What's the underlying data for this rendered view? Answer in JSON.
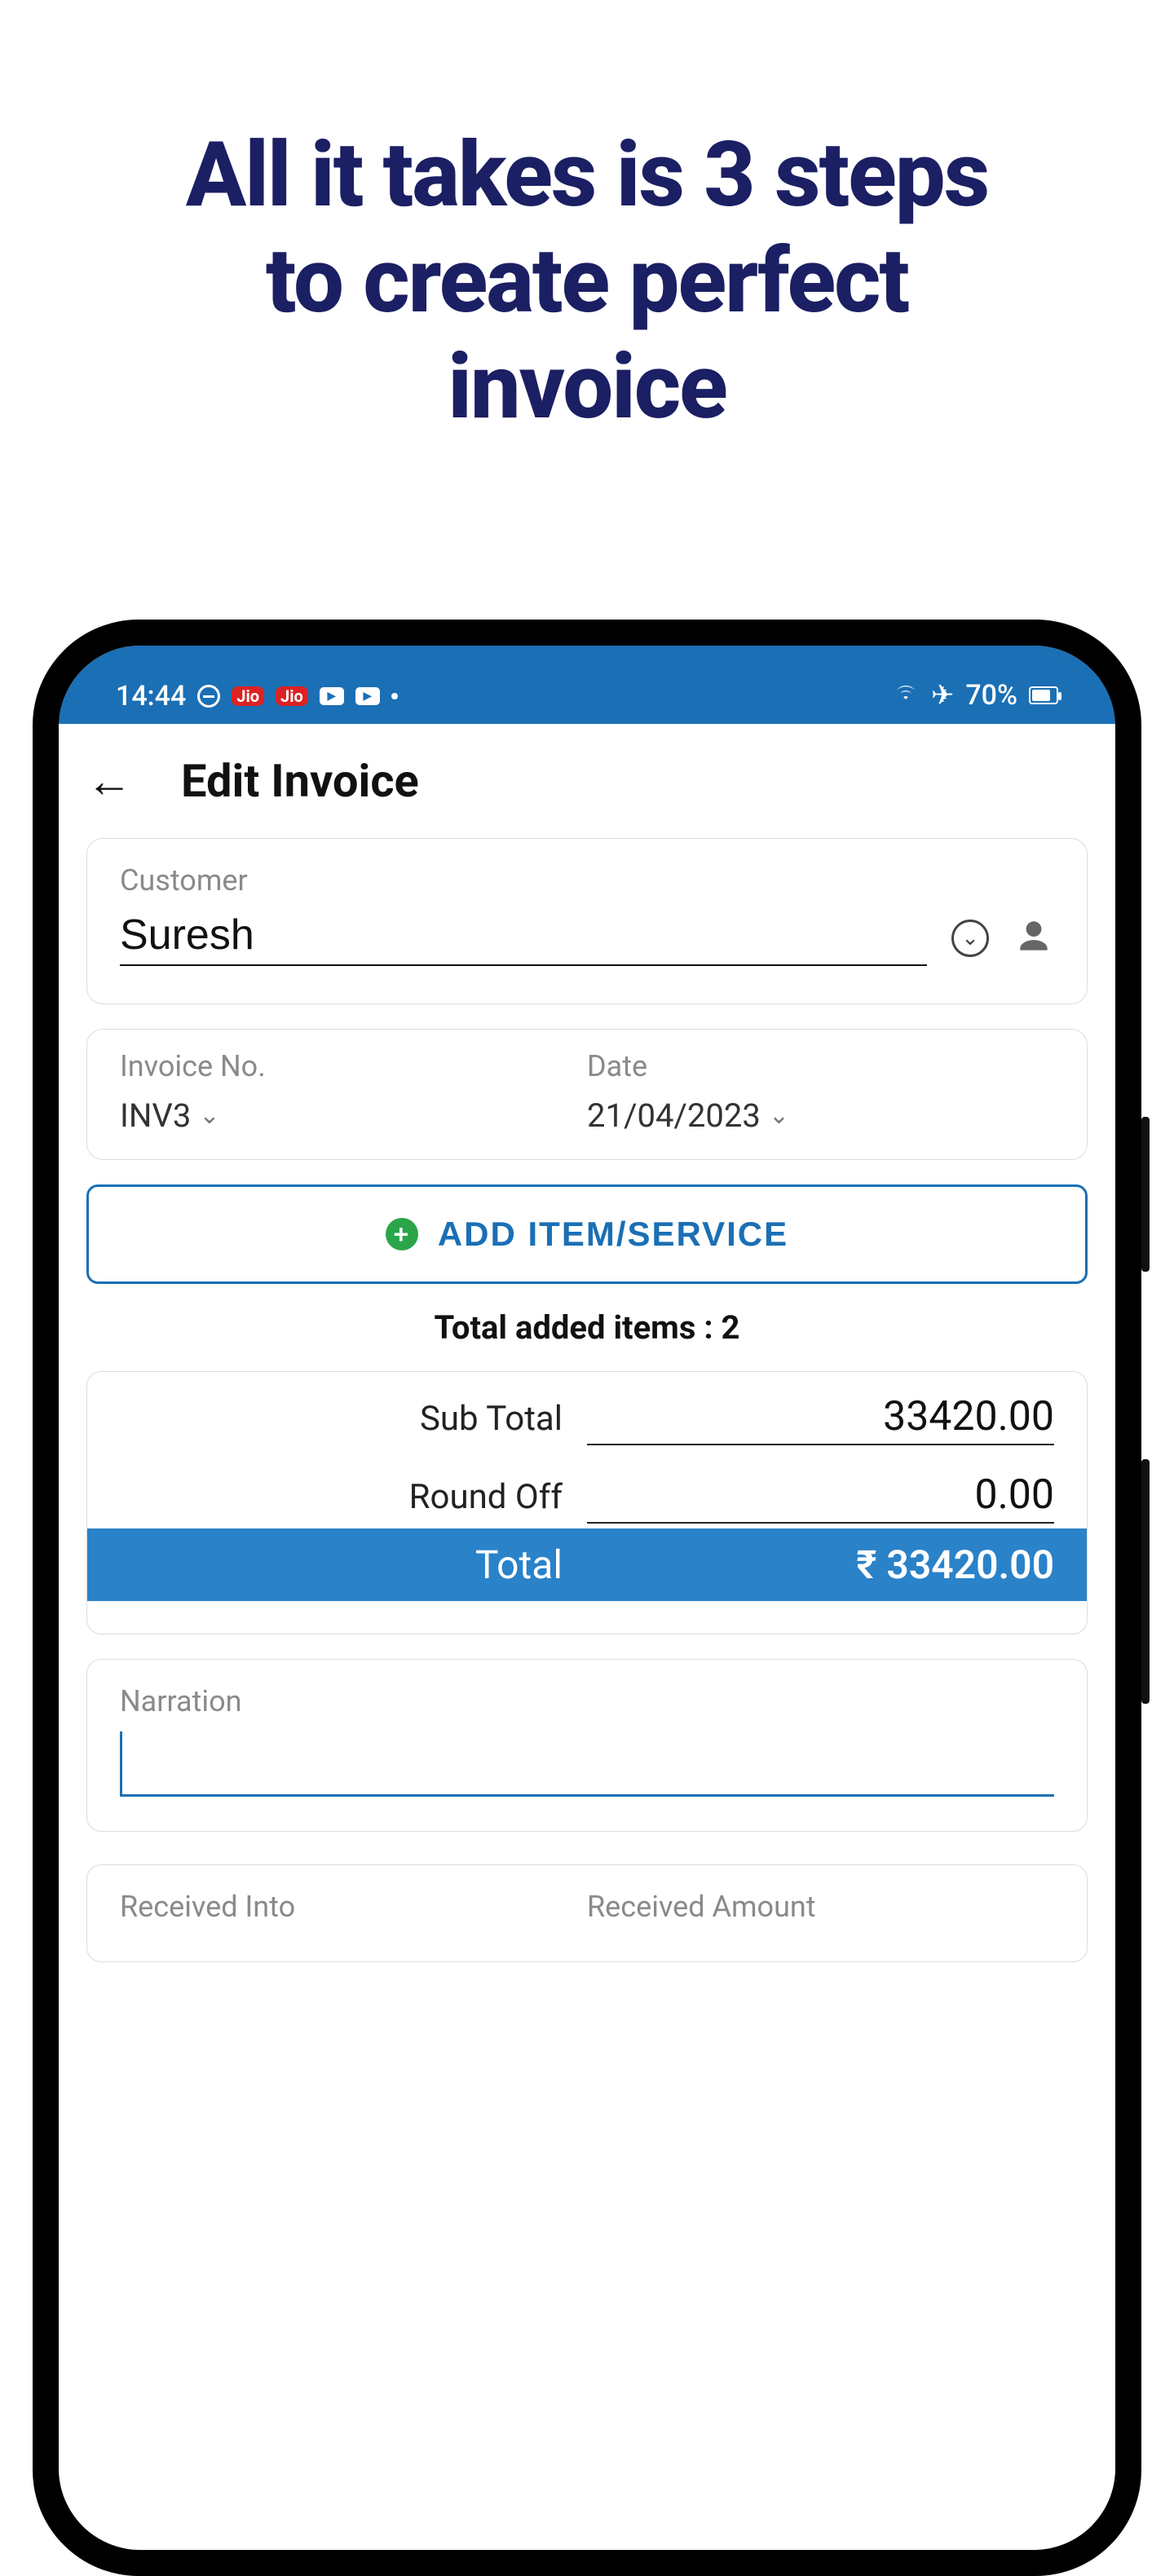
{
  "headline": {
    "line1": "All it takes is 3 steps",
    "line2": "to create perfect",
    "line3": "invoice"
  },
  "statusbar": {
    "time": "14:44",
    "jio": "Jio",
    "battery_text": "70%"
  },
  "appbar": {
    "title": "Edit Invoice"
  },
  "customer": {
    "label": "Customer",
    "value": "Suresh"
  },
  "invoice": {
    "no_label": "Invoice No.",
    "no_value": "INV3",
    "date_label": "Date",
    "date_value": "21/04/2023"
  },
  "add_button": "ADD ITEM/SERVICE",
  "items_count_prefix": "Total added items : ",
  "items_count": "2",
  "totals": {
    "subtotal_label": "Sub Total",
    "subtotal_value": "33420.00",
    "roundoff_label": "Round Off",
    "roundoff_value": "0.00",
    "total_label": "Total",
    "total_value": "₹ 33420.00"
  },
  "narration": {
    "label": "Narration",
    "value": ""
  },
  "received": {
    "into_label": "Received Into",
    "amount_label": "Received Amount"
  }
}
